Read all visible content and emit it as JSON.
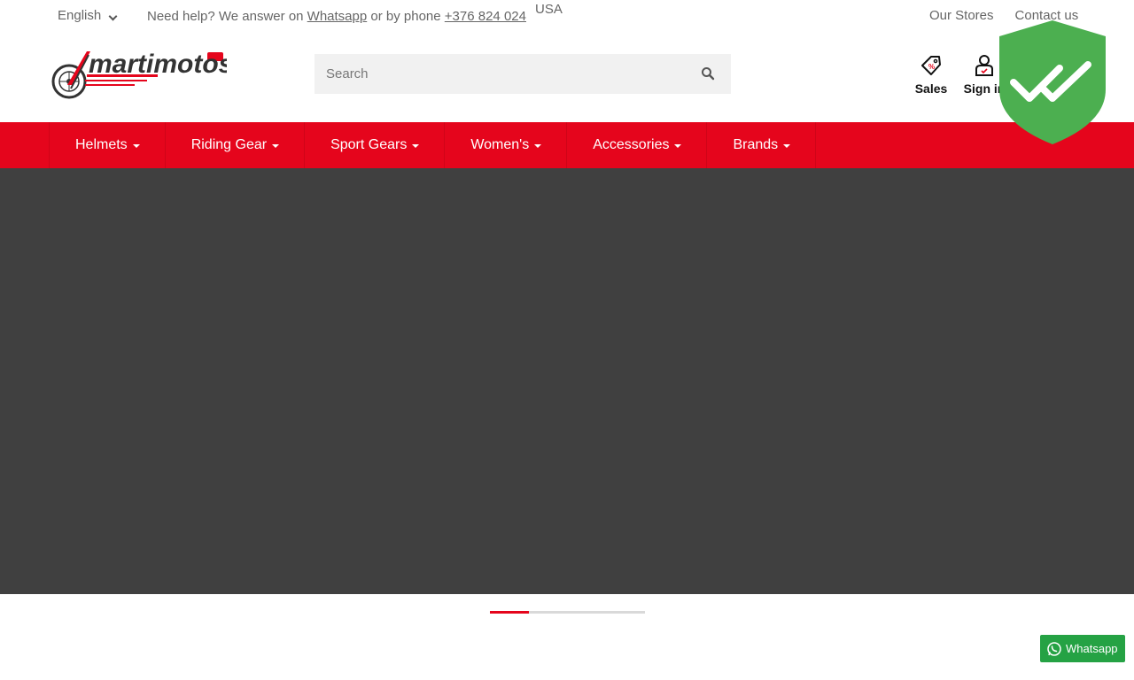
{
  "topbar": {
    "language": "English",
    "help_text": "Need help? We answer on",
    "whatsapp_link": "Whatsapp",
    "phone_text": "or by phone",
    "phone_link": "+376 824 024",
    "region": "USA",
    "our_stores": "Our Stores",
    "contact_us": "Contact us"
  },
  "header": {
    "logo_text": "martimotos",
    "search_placeholder": "Search",
    "sales_label": "Sales",
    "signin_label": "Sign in"
  },
  "nav": {
    "items": [
      {
        "label": "Helmets"
      },
      {
        "label": "Riding Gear"
      },
      {
        "label": "Sport Gears"
      },
      {
        "label": "Women's"
      },
      {
        "label": "Accessories"
      },
      {
        "label": "Brands"
      }
    ]
  },
  "slider": {
    "progress_fraction": 0.25
  },
  "float_button": {
    "label": "Whatsapp"
  },
  "colors": {
    "brand_red": "#e5051c",
    "hero_bg": "#404040",
    "badge_green": "#4caf50",
    "whatsapp_green": "#25a244"
  },
  "icons": {
    "search": "search-icon",
    "sales": "price-tag-icon",
    "signin": "user-icon",
    "badge": "shield-check-icon",
    "whatsapp": "whatsapp-icon"
  }
}
